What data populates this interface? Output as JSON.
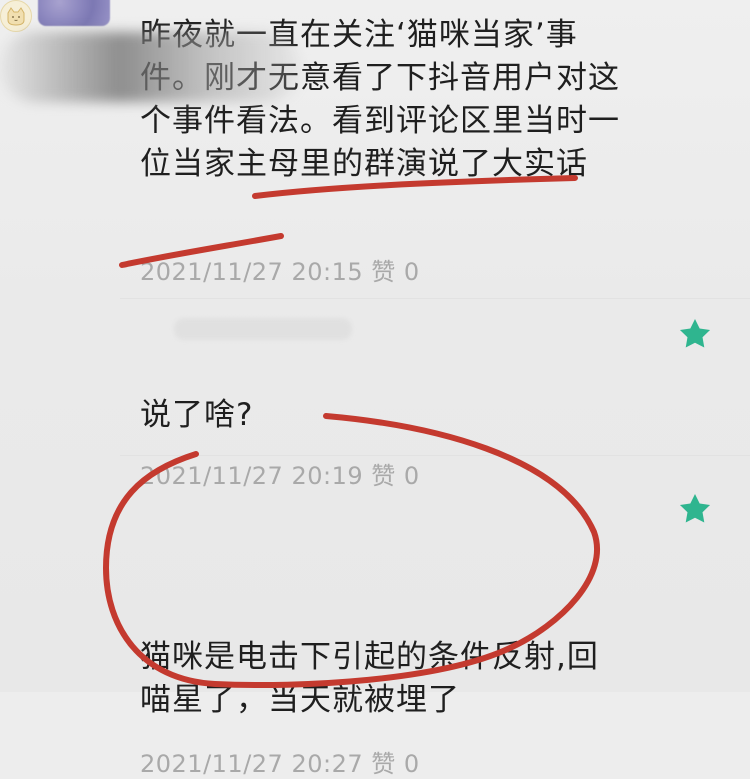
{
  "comments": [
    {
      "text": "昨夜就一直在关注‘猫咪当家’事件。刚才无意看了下抖音用户对这个事件看法。看到评论区里当时一位当家主母里的群演说了大实话",
      "timestamp": "2021/11/27 20:15",
      "likes_label": "赞 0"
    },
    {
      "text": "说了啥?",
      "timestamp": "2021/11/27 20:19",
      "likes_label": "赞 0"
    },
    {
      "text": "猫咪是电击下引起的条件反射,回喵星了，当天就被埋了",
      "timestamp": "2021/11/27 20:27",
      "likes_label": "赞 0"
    }
  ],
  "colors": {
    "background": "#ededed",
    "text": "#1f1f1f",
    "meta": "#a9a9a9",
    "star": "#2fb58f",
    "annotation": "#c43a2f"
  },
  "icons": {
    "star_1": "star-icon",
    "star_2": "star-icon",
    "avatar_2": "cat-avatar-icon"
  }
}
